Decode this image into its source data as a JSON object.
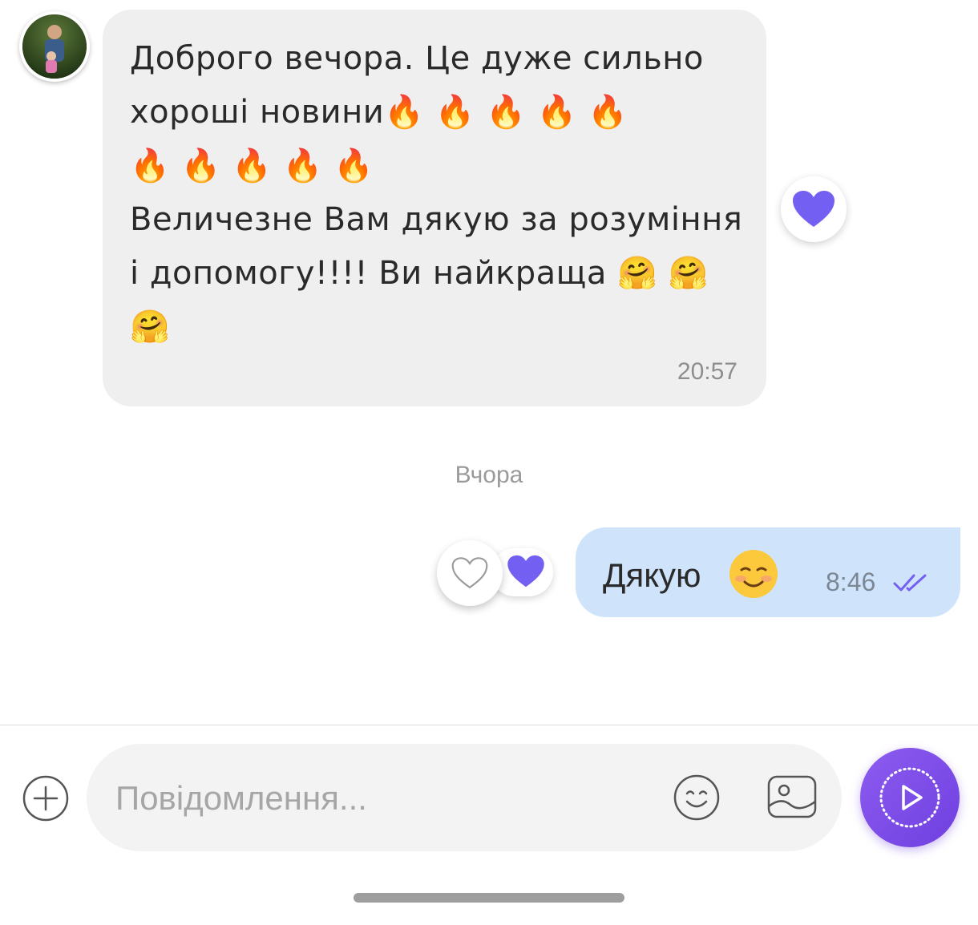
{
  "conversation": {
    "incoming": {
      "text": "Доброго вечора. Це дуже сильно хороші новини🔥 🔥 🔥 🔥 🔥\n🔥 🔥 🔥 🔥 🔥\nВеличезне Вам дякую за розуміння і допомогу!!!! Ви найкраща 🤗 🤗\n🤗",
      "time": "20:57",
      "reaction_icon": "purple-heart-icon"
    },
    "date_separator": "Вчора",
    "outgoing": {
      "text": "Дякую",
      "emoji_icon": "smiling-face-icon",
      "time": "8:46",
      "status_icon": "double-check-icon",
      "reaction_icon": "purple-heart-icon",
      "add_reaction_icon": "heart-outline-icon"
    }
  },
  "composer": {
    "placeholder": "Повідомлення...",
    "value": ""
  },
  "colors": {
    "accent": "#7360f2",
    "incoming_bubble": "#efefef",
    "outgoing_bubble": "#cfe4fb"
  }
}
